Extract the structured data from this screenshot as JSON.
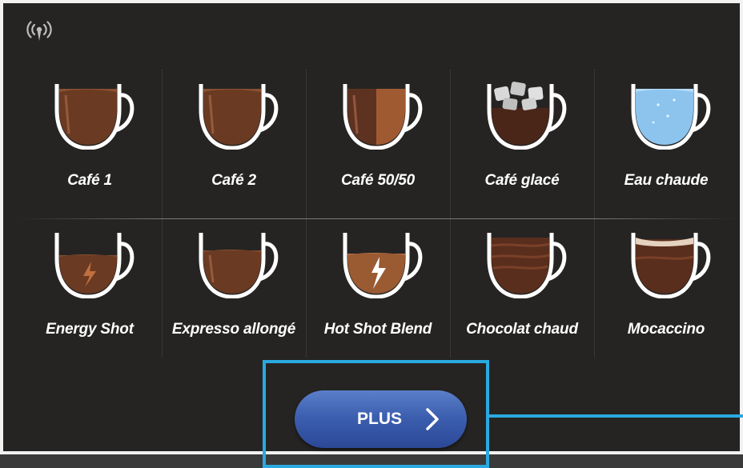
{
  "status": {
    "icon": "wireless-signal-icon"
  },
  "drinks": [
    {
      "label": "Café 1",
      "icon": "coffee-cup-icon",
      "fill": "#6b3a22"
    },
    {
      "label": "Café 2",
      "icon": "coffee-cup-icon",
      "fill": "#6b3a22"
    },
    {
      "label": "Café 50/50",
      "icon": "coffee-half-half-cup-icon",
      "fill": "#6b3a22"
    },
    {
      "label": "Café glacé",
      "icon": "iced-coffee-cup-icon",
      "fill": "#4a2618"
    },
    {
      "label": "Eau chaude",
      "icon": "hot-water-cup-icon",
      "fill": "#8cc4ee"
    },
    {
      "label": "Energy Shot",
      "icon": "energy-shot-cup-icon",
      "fill": "#6b3a22"
    },
    {
      "label": "Expresso allongé",
      "icon": "long-espresso-cup-icon",
      "fill": "#6b3a22"
    },
    {
      "label": "Hot Shot Blend",
      "icon": "hot-shot-blend-cup-icon",
      "fill": "#9a5a32"
    },
    {
      "label": "Chocolat chaud",
      "icon": "hot-chocolate-cup-icon",
      "fill": "#5a2e1c"
    },
    {
      "label": "Mocaccino",
      "icon": "mocaccino-cup-icon",
      "fill": "#5a2e1c"
    }
  ],
  "more_button": {
    "label": "PLUS",
    "icon": "chevron-right-icon"
  },
  "colors": {
    "background": "#252423",
    "frame": "#f2f2f2",
    "button": "#3d5fb0",
    "highlight": "#2aa9e0"
  }
}
